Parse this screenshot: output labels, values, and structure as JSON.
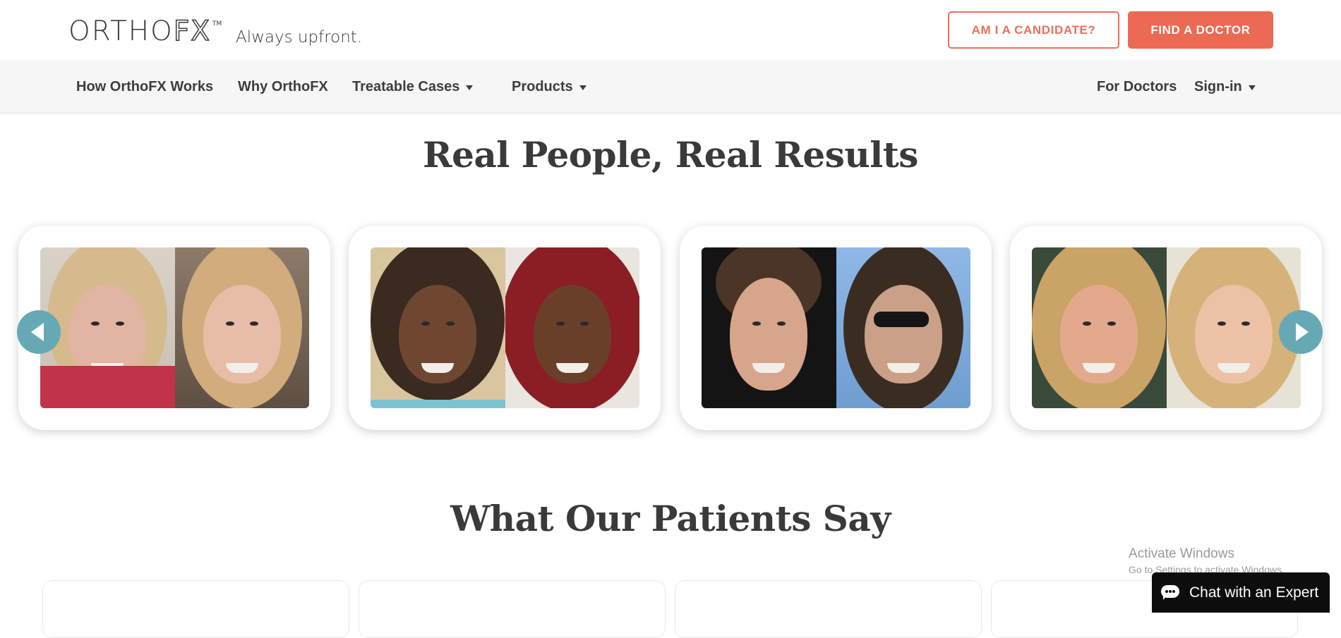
{
  "header": {
    "logo_ortho": "ORTHO",
    "logo_fx": "FX",
    "logo_tm": "TM",
    "tagline": "Always upfront.",
    "candidate_button": "AM I A CANDIDATE?",
    "find_doctor_button": "FIND A DOCTOR"
  },
  "nav": {
    "how": "How OrthoFX Works",
    "why": "Why OrthoFX",
    "treatable": "Treatable Cases",
    "products": "Products",
    "doctors": "For Doctors",
    "signin": "Sign-in"
  },
  "results": {
    "title": "Real People, Real Results"
  },
  "patients": {
    "title": "What Our Patients Say"
  },
  "watermark": {
    "title": "Activate Windows",
    "subtitle": "Go to Settings to activate Windows."
  },
  "chat": {
    "label": "Chat with an Expert"
  },
  "colors": {
    "accent": "#ec6a53",
    "arrow": "#66a9b5",
    "chat_bg": "#0d0d0d"
  },
  "icons": {
    "prev": "chevron-left-icon",
    "next": "chevron-right-icon",
    "chat": "chat-bubble-icon",
    "caret": "caret-down-icon"
  }
}
